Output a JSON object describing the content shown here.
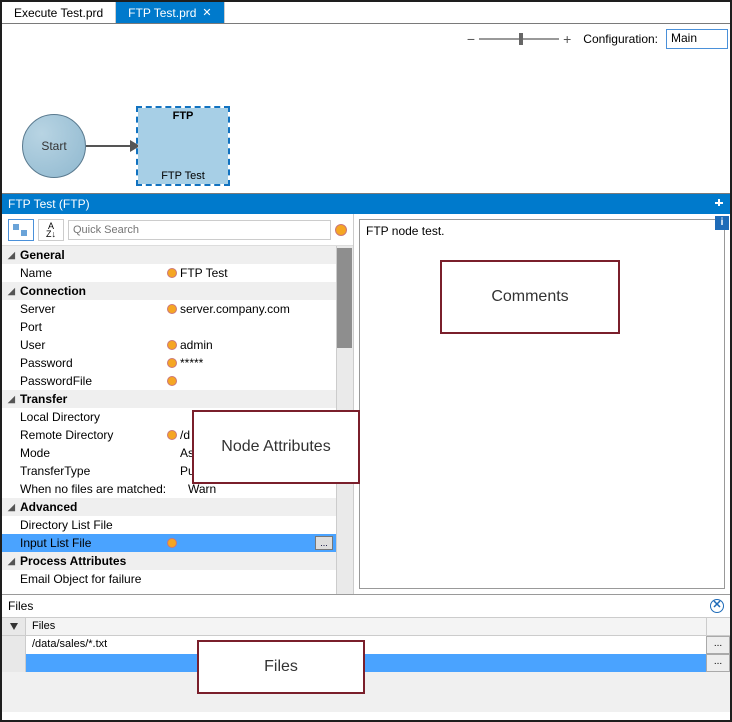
{
  "tabs": [
    {
      "label": "Execute Test.prd",
      "active": false
    },
    {
      "label": "FTP Test.prd",
      "active": true
    }
  ],
  "config": {
    "label": "Configuration:",
    "value": "Main"
  },
  "diagram": {
    "start_label": "Start",
    "ftp_header": "FTP",
    "ftp_footer": "FTP Test"
  },
  "panel_title": "FTP Test (FTP)",
  "search_placeholder": "Quick Search",
  "comments_text": "FTP node test.",
  "sections": {
    "general": "General",
    "connection": "Connection",
    "transfer": "Transfer",
    "advanced": "Advanced",
    "process": "Process Attributes"
  },
  "props": {
    "name_k": "Name",
    "name_v": "FTP Test",
    "server_k": "Server",
    "server_v": "server.company.com",
    "port_k": "Port",
    "port_v": "",
    "user_k": "User",
    "user_v": "admin",
    "password_k": "Password",
    "password_v": "*****",
    "passwordfile_k": "PasswordFile",
    "passwordfile_v": "",
    "localdir_k": "Local Directory",
    "localdir_v": "",
    "remotedir_k": "Remote Directory",
    "remotedir_v": "/d",
    "mode_k": "Mode",
    "mode_v": "Ascii",
    "ttype_k": "TransferType",
    "ttype_v": "Pull",
    "nomatch_k": "When no files are matched:",
    "nomatch_v": "Warn",
    "dirlist_k": "Directory List File",
    "dirlist_v": "",
    "inlist_k": "Input List File",
    "inlist_v": "",
    "email_k": "Email Object for failure",
    "email_v": ""
  },
  "files": {
    "panel_label": "Files",
    "col_header": "Files",
    "row1": "/data/sales/*.txt"
  },
  "callouts": {
    "node_attrs": "Node Attributes",
    "comments": "Comments",
    "files": "Files"
  }
}
